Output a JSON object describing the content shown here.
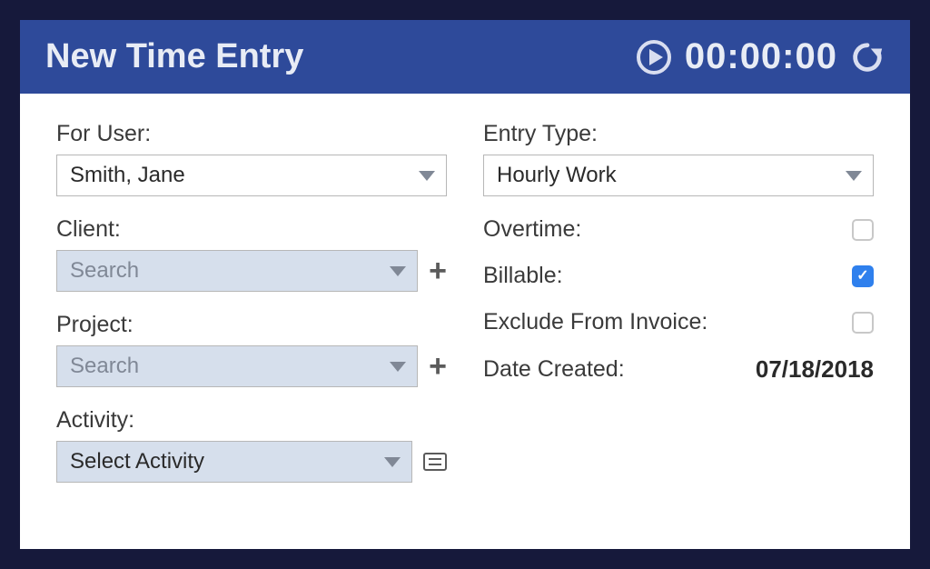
{
  "header": {
    "title": "New Time Entry",
    "timer": "00:00:00"
  },
  "left": {
    "for_user": {
      "label": "For User:",
      "value": "Smith, Jane"
    },
    "client": {
      "label": "Client:",
      "placeholder": "Search"
    },
    "project": {
      "label": "Project:",
      "placeholder": "Search"
    },
    "activity": {
      "label": "Activity:",
      "placeholder": "Select Activity"
    }
  },
  "right": {
    "entry_type": {
      "label": "Entry Type:",
      "value": "Hourly Work"
    },
    "overtime": {
      "label": "Overtime:",
      "checked": false
    },
    "billable": {
      "label": "Billable:",
      "checked": true
    },
    "exclude": {
      "label": "Exclude From Invoice:",
      "checked": false
    },
    "date_created": {
      "label": "Date Created:",
      "value": "07/18/2018"
    }
  }
}
